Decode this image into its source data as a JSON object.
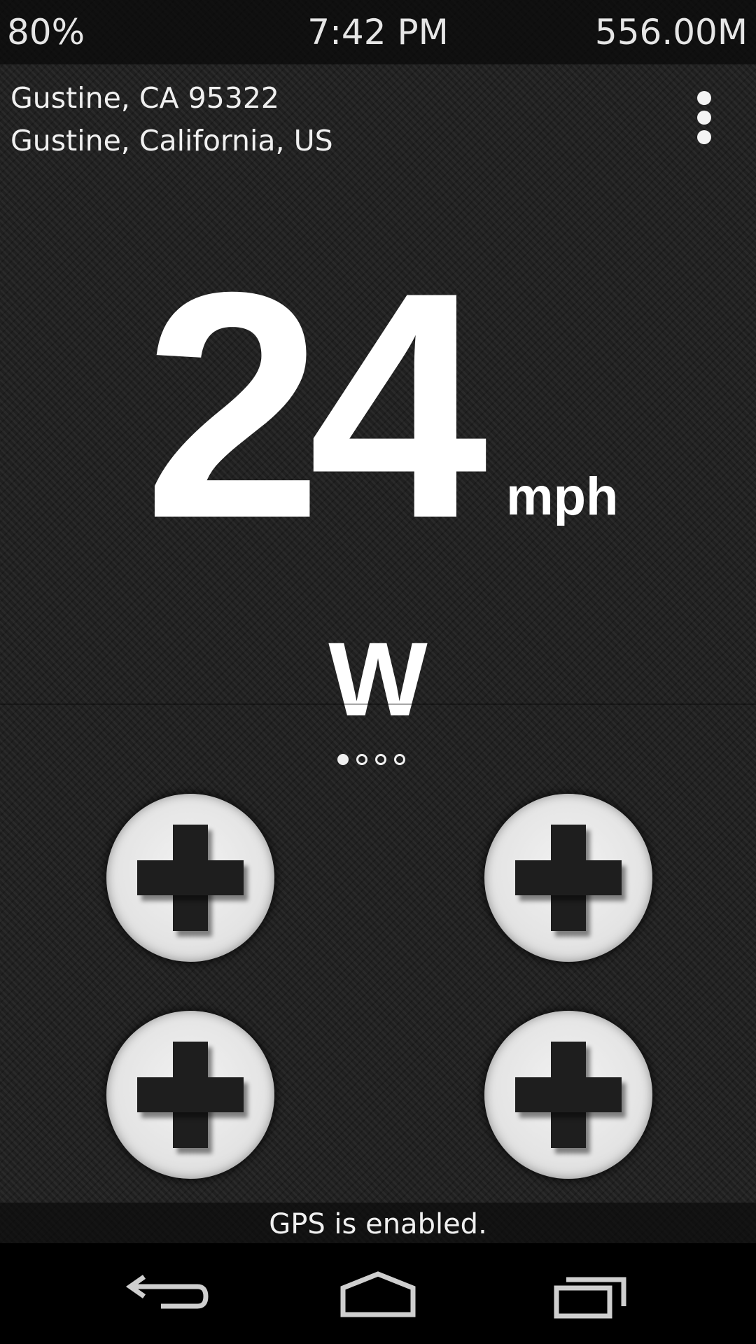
{
  "status_bar": {
    "battery": "80%",
    "time": "7:42 PM",
    "memory": "556.00M"
  },
  "location": {
    "line1": "Gustine, CA 95322",
    "line2": "Gustine, California, US"
  },
  "menu": {
    "icon": "overflow-menu-icon"
  },
  "speed": {
    "value": "24",
    "unit": "mph"
  },
  "heading": {
    "direction": "W"
  },
  "pager": {
    "total": 4,
    "active_index": 0
  },
  "add_buttons": [
    {
      "icon": "plus-icon"
    },
    {
      "icon": "plus-icon"
    },
    {
      "icon": "plus-icon"
    },
    {
      "icon": "plus-icon"
    }
  ],
  "gps_status": "GPS is enabled.",
  "nav_bar": {
    "back_icon": "back-icon",
    "home_icon": "home-icon",
    "recent_icon": "recent-apps-icon"
  },
  "colors": {
    "background": "#202020",
    "text": "#ffffff",
    "button_face": "#e4e4e4",
    "plus": "#1e1e1e"
  }
}
